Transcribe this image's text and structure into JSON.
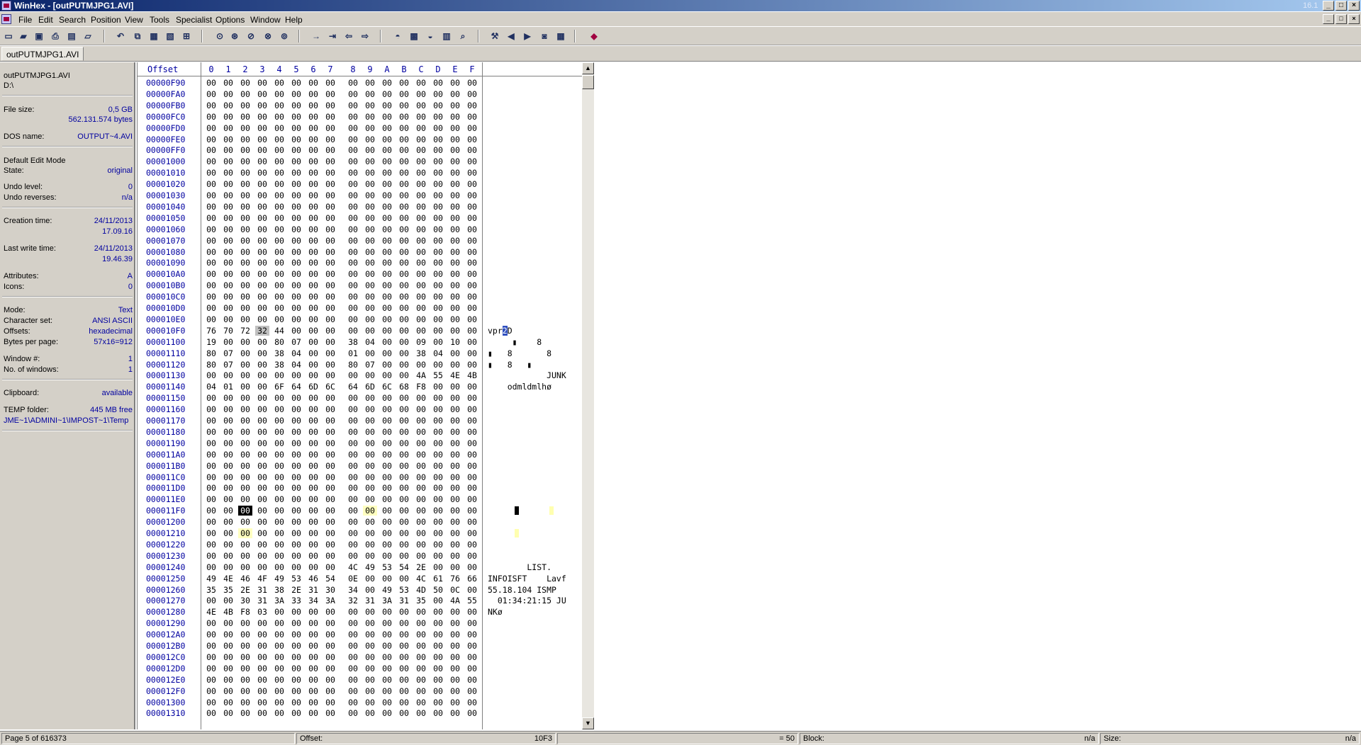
{
  "window": {
    "title": "WinHex - [outPUTMJPG1.AVI]",
    "version_badge": "16.1",
    "caption_buttons": [
      "_",
      "□",
      "×"
    ]
  },
  "menu": [
    "File",
    "Edit",
    "Search",
    "Position",
    "View",
    "Tools",
    "Specialist",
    "Options",
    "Window",
    "Help"
  ],
  "toolbar_icons": [
    "new-file-icon",
    "open-folder-icon",
    "save-icon",
    "print-icon",
    "properties-icon",
    "open-recent-icon",
    "undo-icon",
    "copy-icon",
    "paste-icon",
    "paste-special-icon",
    "write-hex-icon",
    "find-text-icon",
    "find-hex-icon",
    "replace-text-icon",
    "replace-hex-icon",
    "find-integer-icon",
    "goto-offset-icon",
    "goto-sector-icon",
    "back-icon",
    "forward-icon",
    "open-disk-icon",
    "ram-editor-icon",
    "drive-icon",
    "calculator-icon",
    "hash-icon",
    "disk-tools-icon",
    "prev-icon",
    "next-icon",
    "snapshot-icon",
    "table-icon",
    "help-book-icon"
  ],
  "file_tab": "outPUTMJPG1.AVI",
  "info": {
    "filename": "outPUTMJPG1.AVI",
    "path": "D:\\",
    "file_size_label": "File size:",
    "file_size": "0,5 GB",
    "file_size_bytes": "562.131.574 bytes",
    "dos_name_label": "DOS name:",
    "dos_name": "OUTPUT~4.AVI",
    "edit_mode": "Default Edit Mode",
    "state_label": "State:",
    "state": "original",
    "undo_level_label": "Undo level:",
    "undo_level": "0",
    "undo_reverses_label": "Undo reverses:",
    "undo_reverses": "n/a",
    "creation_label": "Creation time:",
    "creation_date": "24/11/2013",
    "creation_time": "17.09.16",
    "lastwrite_label": "Last write time:",
    "lastwrite_date": "24/11/2013",
    "lastwrite_time": "19.46.39",
    "attributes_label": "Attributes:",
    "attributes": "A",
    "icons_label": "Icons:",
    "icons": "0",
    "mode_label": "Mode:",
    "mode": "Text",
    "charset_label": "Character set:",
    "charset": "ANSI ASCII",
    "offsets_label": "Offsets:",
    "offsets": "hexadecimal",
    "bpp_label": "Bytes per page:",
    "bpp": "57x16=912",
    "window_no_label": "Window #:",
    "window_no": "1",
    "windows_label": "No. of windows:",
    "windows": "1",
    "clipboard_label": "Clipboard:",
    "clipboard": "available",
    "temp_label": "TEMP folder:",
    "temp_free": "445 MB free",
    "temp_path": "JME~1\\ADMINI~1\\IMPOST~1\\Temp"
  },
  "hex": {
    "offset_header": "Offset",
    "columns": [
      "0",
      "1",
      "2",
      "3",
      "4",
      "5",
      "6",
      "7",
      "8",
      "9",
      "A",
      "B",
      "C",
      "D",
      "E",
      "F"
    ],
    "rows": [
      {
        "offset": "00000F90",
        "bytes": "00 00 00 00 00 00 00 00 00 00 00 00 00 00 00 00",
        "text": ""
      },
      {
        "offset": "00000FA0",
        "bytes": "00 00 00 00 00 00 00 00 00 00 00 00 00 00 00 00",
        "text": ""
      },
      {
        "offset": "00000FB0",
        "bytes": "00 00 00 00 00 00 00 00 00 00 00 00 00 00 00 00",
        "text": ""
      },
      {
        "offset": "00000FC0",
        "bytes": "00 00 00 00 00 00 00 00 00 00 00 00 00 00 00 00",
        "text": ""
      },
      {
        "offset": "00000FD0",
        "bytes": "00 00 00 00 00 00 00 00 00 00 00 00 00 00 00 00",
        "text": ""
      },
      {
        "offset": "00000FE0",
        "bytes": "00 00 00 00 00 00 00 00 00 00 00 00 00 00 00 00",
        "text": ""
      },
      {
        "offset": "00000FF0",
        "bytes": "00 00 00 00 00 00 00 00 00 00 00 00 00 00 00 00",
        "text": ""
      },
      {
        "offset": "00001000",
        "bytes": "00 00 00 00 00 00 00 00 00 00 00 00 00 00 00 00",
        "text": ""
      },
      {
        "offset": "00001010",
        "bytes": "00 00 00 00 00 00 00 00 00 00 00 00 00 00 00 00",
        "text": ""
      },
      {
        "offset": "00001020",
        "bytes": "00 00 00 00 00 00 00 00 00 00 00 00 00 00 00 00",
        "text": ""
      },
      {
        "offset": "00001030",
        "bytes": "00 00 00 00 00 00 00 00 00 00 00 00 00 00 00 00",
        "text": ""
      },
      {
        "offset": "00001040",
        "bytes": "00 00 00 00 00 00 00 00 00 00 00 00 00 00 00 00",
        "text": ""
      },
      {
        "offset": "00001050",
        "bytes": "00 00 00 00 00 00 00 00 00 00 00 00 00 00 00 00",
        "text": ""
      },
      {
        "offset": "00001060",
        "bytes": "00 00 00 00 00 00 00 00 00 00 00 00 00 00 00 00",
        "text": ""
      },
      {
        "offset": "00001070",
        "bytes": "00 00 00 00 00 00 00 00 00 00 00 00 00 00 00 00",
        "text": ""
      },
      {
        "offset": "00001080",
        "bytes": "00 00 00 00 00 00 00 00 00 00 00 00 00 00 00 00",
        "text": ""
      },
      {
        "offset": "00001090",
        "bytes": "00 00 00 00 00 00 00 00 00 00 00 00 00 00 00 00",
        "text": ""
      },
      {
        "offset": "000010A0",
        "bytes": "00 00 00 00 00 00 00 00 00 00 00 00 00 00 00 00",
        "text": ""
      },
      {
        "offset": "000010B0",
        "bytes": "00 00 00 00 00 00 00 00 00 00 00 00 00 00 00 00",
        "text": ""
      },
      {
        "offset": "000010C0",
        "bytes": "00 00 00 00 00 00 00 00 00 00 00 00 00 00 00 00",
        "text": ""
      },
      {
        "offset": "000010D0",
        "bytes": "00 00 00 00 00 00 00 00 00 00 00 00 00 00 00 00",
        "text": ""
      },
      {
        "offset": "000010E0",
        "bytes": "00 00 00 00 00 00 00 00 00 00 00 00 00 00 00 00",
        "text": ""
      },
      {
        "offset": "000010F0",
        "bytes": "76 70 72 32 44 00 00 00 00 00 00 00 00 00 00 00",
        "text": "vpr2D",
        "sel": 3,
        "textcursor": 3
      },
      {
        "offset": "00001100",
        "bytes": "19 00 00 00 80 07 00 00 38 04 00 00 09 00 10 00",
        "text": "     ▮    8"
      },
      {
        "offset": "00001110",
        "bytes": "80 07 00 00 38 04 00 00 01 00 00 00 38 04 00 00",
        "text": "▮   8       8"
      },
      {
        "offset": "00001120",
        "bytes": "80 07 00 00 38 04 00 00 80 07 00 00 00 00 00 00",
        "text": "▮   8   ▮"
      },
      {
        "offset": "00001130",
        "bytes": "00 00 00 00 00 00 00 00 00 00 00 00 4A 55 4E 4B",
        "text": "            JUNK"
      },
      {
        "offset": "00001140",
        "bytes": "04 01 00 00 6F 64 6D 6C 64 6D 6C 68 F8 00 00 00",
        "text": "    odmldmlhø"
      },
      {
        "offset": "00001150",
        "bytes": "00 00 00 00 00 00 00 00 00 00 00 00 00 00 00 00",
        "text": ""
      },
      {
        "offset": "00001160",
        "bytes": "00 00 00 00 00 00 00 00 00 00 00 00 00 00 00 00",
        "text": ""
      },
      {
        "offset": "00001170",
        "bytes": "00 00 00 00 00 00 00 00 00 00 00 00 00 00 00 00",
        "text": ""
      },
      {
        "offset": "00001180",
        "bytes": "00 00 00 00 00 00 00 00 00 00 00 00 00 00 00 00",
        "text": ""
      },
      {
        "offset": "00001190",
        "bytes": "00 00 00 00 00 00 00 00 00 00 00 00 00 00 00 00",
        "text": ""
      },
      {
        "offset": "000011A0",
        "bytes": "00 00 00 00 00 00 00 00 00 00 00 00 00 00 00 00",
        "text": ""
      },
      {
        "offset": "000011B0",
        "bytes": "00 00 00 00 00 00 00 00 00 00 00 00 00 00 00 00",
        "text": ""
      },
      {
        "offset": "000011C0",
        "bytes": "00 00 00 00 00 00 00 00 00 00 00 00 00 00 00 00",
        "text": ""
      },
      {
        "offset": "000011D0",
        "bytes": "00 00 00 00 00 00 00 00 00 00 00 00 00 00 00 00",
        "text": ""
      },
      {
        "offset": "000011E0",
        "bytes": "00 00 00 00 00 00 00 00 00 00 00 00 00 00 00 00",
        "text": ""
      },
      {
        "offset": "000011F0",
        "bytes": "00 00 00 00 00 00 00 00 00 00 00 00 00 00 00 00",
        "text": "",
        "cursor": 2,
        "hl": [
          9
        ],
        "marks": [
          {
            "col": 2,
            "kind": "blk"
          },
          {
            "col": 9,
            "kind": "yel"
          }
        ]
      },
      {
        "offset": "00001200",
        "bytes": "00 00 00 00 00 00 00 00 00 00 00 00 00 00 00 00",
        "text": ""
      },
      {
        "offset": "00001210",
        "bytes": "00 00 00 00 00 00 00 00 00 00 00 00 00 00 00 00",
        "text": "",
        "hl": [
          2
        ],
        "marks": [
          {
            "col": 2,
            "kind": "yel"
          }
        ]
      },
      {
        "offset": "00001220",
        "bytes": "00 00 00 00 00 00 00 00 00 00 00 00 00 00 00 00",
        "text": ""
      },
      {
        "offset": "00001230",
        "bytes": "00 00 00 00 00 00 00 00 00 00 00 00 00 00 00 00",
        "text": ""
      },
      {
        "offset": "00001240",
        "bytes": "00 00 00 00 00 00 00 00 4C 49 53 54 2E 00 00 00",
        "text": "        LIST."
      },
      {
        "offset": "00001250",
        "bytes": "49 4E 46 4F 49 53 46 54 0E 00 00 00 4C 61 76 66",
        "text": "INFOISFT    Lavf"
      },
      {
        "offset": "00001260",
        "bytes": "35 35 2E 31 38 2E 31 30 34 00 49 53 4D 50 0C 00",
        "text": "55.18.104 ISMP"
      },
      {
        "offset": "00001270",
        "bytes": "00 00 30 31 3A 33 34 3A 32 31 3A 31 35 00 4A 55",
        "text": "  01:34:21:15 JU"
      },
      {
        "offset": "00001280",
        "bytes": "4E 4B F8 03 00 00 00 00 00 00 00 00 00 00 00 00",
        "text": "NKø"
      },
      {
        "offset": "00001290",
        "bytes": "00 00 00 00 00 00 00 00 00 00 00 00 00 00 00 00",
        "text": ""
      },
      {
        "offset": "000012A0",
        "bytes": "00 00 00 00 00 00 00 00 00 00 00 00 00 00 00 00",
        "text": ""
      },
      {
        "offset": "000012B0",
        "bytes": "00 00 00 00 00 00 00 00 00 00 00 00 00 00 00 00",
        "text": ""
      },
      {
        "offset": "000012C0",
        "bytes": "00 00 00 00 00 00 00 00 00 00 00 00 00 00 00 00",
        "text": ""
      },
      {
        "offset": "000012D0",
        "bytes": "00 00 00 00 00 00 00 00 00 00 00 00 00 00 00 00",
        "text": ""
      },
      {
        "offset": "000012E0",
        "bytes": "00 00 00 00 00 00 00 00 00 00 00 00 00 00 00 00",
        "text": ""
      },
      {
        "offset": "000012F0",
        "bytes": "00 00 00 00 00 00 00 00 00 00 00 00 00 00 00 00",
        "text": ""
      },
      {
        "offset": "00001300",
        "bytes": "00 00 00 00 00 00 00 00 00 00 00 00 00 00 00 00",
        "text": ""
      },
      {
        "offset": "00001310",
        "bytes": "00 00 00 00 00 00 00 00 00 00 00 00 00 00 00 00",
        "text": ""
      }
    ]
  },
  "status": {
    "page": "Page 5 of 616373",
    "offset_label": "Offset:",
    "offset_value": "10F3",
    "value": "= 50",
    "block_label": "Block:",
    "block_value": "n/a",
    "size_label": "Size:",
    "size_value": "n/a"
  },
  "colors": {
    "title_start": "#0a246a",
    "title_end": "#a6caf0",
    "chrome": "#d4d0c8",
    "offset_text": "#0000a0",
    "highlight": "#ffffc0"
  }
}
